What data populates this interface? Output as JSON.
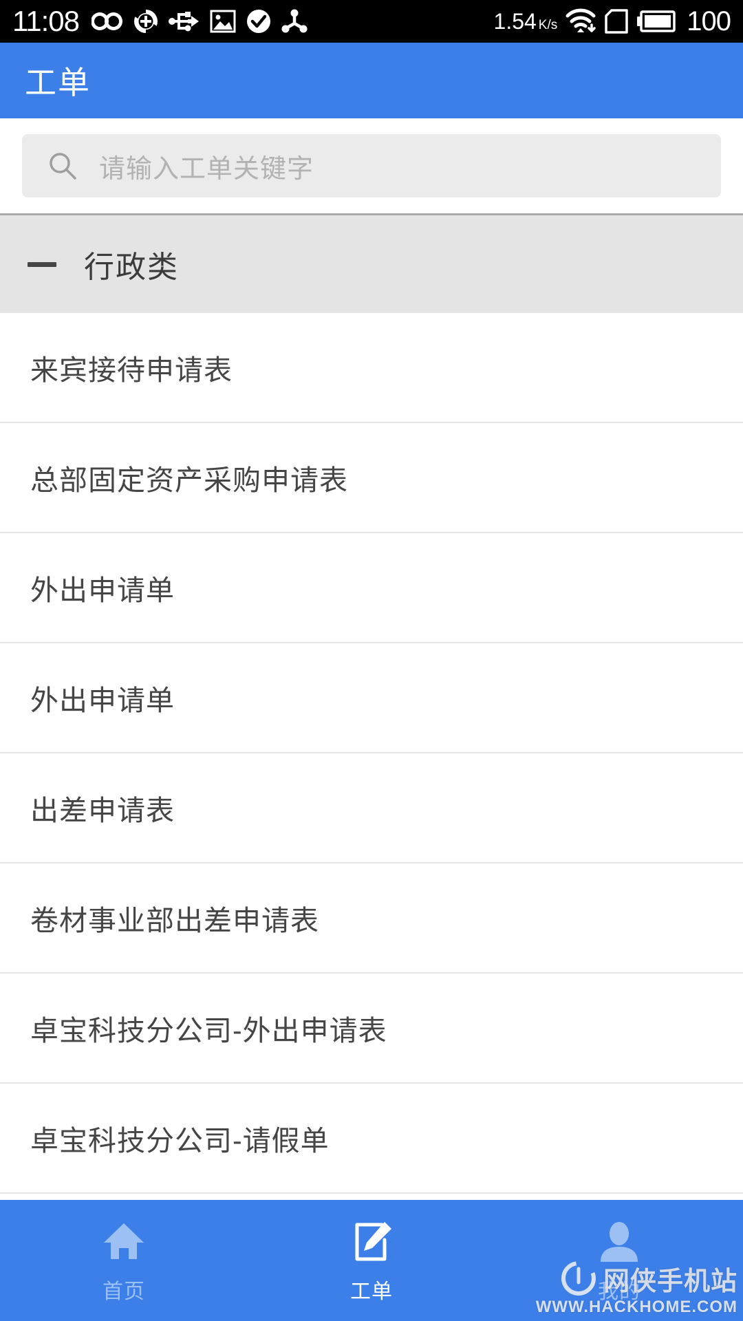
{
  "status_bar": {
    "clock": "11:08",
    "network_speed": "1.54",
    "network_speed_unit": "K/s",
    "battery_level": "100",
    "icons": [
      "infinity-icon",
      "circle-plus-icon",
      "usb-icon",
      "image-icon",
      "check-circle-icon",
      "share-node-icon",
      "wifi-download-icon",
      "sd-card-icon",
      "battery-full-icon"
    ]
  },
  "app_bar": {
    "title": "工单"
  },
  "search": {
    "placeholder": "请输入工单关键字",
    "value": "",
    "icon": "search-icon"
  },
  "group": {
    "label": "行政类",
    "collapse_icon": "minus-icon",
    "expanded": true
  },
  "list": {
    "items": [
      {
        "label": "来宾接待申请表"
      },
      {
        "label": "总部固定资产采购申请表"
      },
      {
        "label": "外出申请单"
      },
      {
        "label": "外出申请单"
      },
      {
        "label": "出差申请表"
      },
      {
        "label": "卷材事业部出差申请表"
      },
      {
        "label": "卓宝科技分公司-外出申请表"
      },
      {
        "label": "卓宝科技分公司-请假单"
      }
    ]
  },
  "bottom_nav": {
    "items": [
      {
        "label": "首页",
        "icon": "home-icon",
        "active": false
      },
      {
        "label": "工单",
        "icon": "edit-document-icon",
        "active": true
      },
      {
        "label": "我的",
        "icon": "person-icon",
        "active": false
      }
    ]
  },
  "watermark": {
    "text": "网侠手机站",
    "url": "WWW.HACKHOME.COM"
  },
  "colors": {
    "brand_blue": "#3d7fe8",
    "nav_inactive": "#9dc0f4",
    "group_bg": "#e4e4e4",
    "search_bg": "#ebebeb",
    "text_primary": "#454545",
    "placeholder": "#b2b2b2"
  }
}
